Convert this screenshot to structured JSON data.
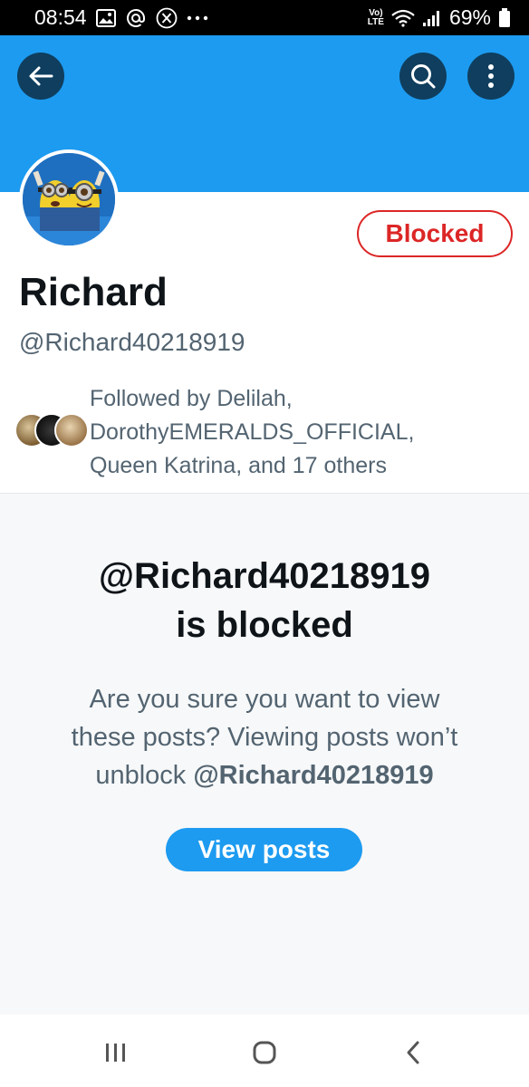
{
  "status_bar": {
    "time": "08:54",
    "left_icons": [
      "gallery-icon",
      "at-icon",
      "x-logo-icon",
      "more-dots-icon"
    ],
    "network_label_top": "Vo)",
    "network_label_bottom": "LTE",
    "battery": "69%",
    "right_icons": [
      "wifi-icon",
      "signal-icon",
      "battery-icon"
    ]
  },
  "header": {
    "back_icon": "arrow-left-icon",
    "search_icon": "search-icon",
    "more_icon": "more-vertical-icon",
    "banner_color": "#1d9bf0"
  },
  "profile": {
    "display_name": "Richard",
    "handle": "@Richard40218919",
    "blocked_label": "Blocked",
    "followed_by": {
      "line1": "Followed by Delilah,",
      "line2": "DorothyEMERALDS_OFFICIAL,",
      "line3": "Queen Katrina, and 17 others"
    }
  },
  "blocked_notice": {
    "title_line1": "@Richard40218919",
    "title_line2": "is blocked",
    "desc_line1": "Are you sure you want to view",
    "desc_line2": "these posts? Viewing posts won’t",
    "desc_line3_prefix": "unblock ",
    "desc_line3_handle": "@Richard40218919",
    "button_label": "View posts"
  },
  "colors": {
    "accent": "#1d9bf0",
    "blocked_red": "#dc2626",
    "muted_text": "#536471",
    "header_button_bg": "#0f3e5e"
  },
  "nav_bar": {
    "recents_icon": "recents-icon",
    "home_icon": "home-icon",
    "back_icon": "back-chevron-icon"
  }
}
